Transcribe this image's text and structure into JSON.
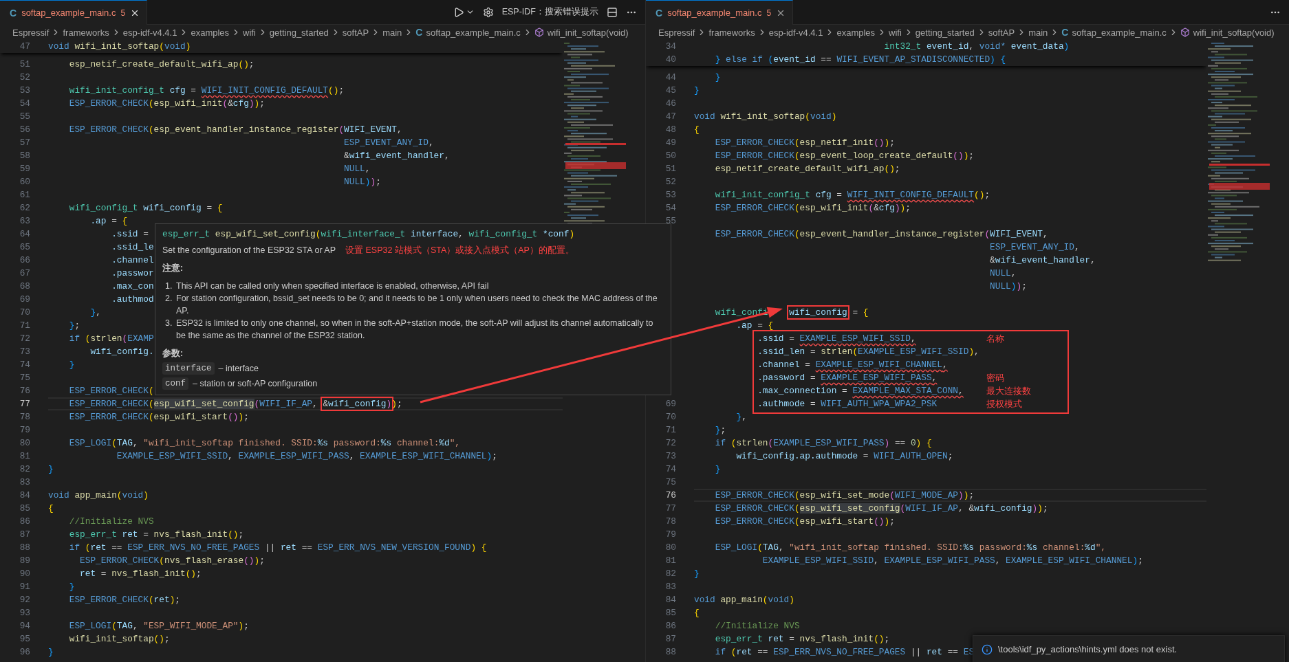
{
  "panes": [
    {
      "tab": {
        "icon": "C",
        "title": "softap_example_main.c",
        "problems": "5",
        "selected": true
      },
      "actions": [
        {
          "kind": "run"
        },
        {
          "kind": "settings"
        },
        {
          "kind": "text",
          "label": "ESP-IDF：搜索错误提示"
        },
        {
          "kind": "split"
        },
        {
          "kind": "more"
        }
      ],
      "breadcrumbs": [
        {
          "kind": "folder",
          "label": "Espressif"
        },
        {
          "kind": "folder",
          "label": "frameworks"
        },
        {
          "kind": "folder",
          "label": "esp-idf-v4.4.1"
        },
        {
          "kind": "folder",
          "label": "examples"
        },
        {
          "kind": "folder",
          "label": "wifi"
        },
        {
          "kind": "folder",
          "label": "getting_started"
        },
        {
          "kind": "folder",
          "label": "softAP"
        },
        {
          "kind": "folder",
          "label": "main"
        },
        {
          "kind": "file",
          "icon": "C",
          "label": "softap_example_main.c"
        },
        {
          "kind": "symbol",
          "label": "wifi_init_softap(void)"
        }
      ],
      "sticky": [
        {
          "n": "47",
          "current": false,
          "tokens": [
            {
              "kind": "keyword",
              "text": "void "
            },
            {
              "kind": "function",
              "text": "wifi_init_softap("
            },
            {
              "kind": "keyword",
              "text": "void)"
            }
          ]
        }
      ],
      "lines": [
        {
          "n": "51",
          "current": false,
          "framed": false,
          "tokens": [
            {
              "kind": "function",
              "text": "    esp_netif_create_default_wifi_ap();"
            }
          ]
        },
        {
          "n": "52",
          "current": false,
          "framed": false
        },
        {
          "n": "53",
          "current": false,
          "framed": false,
          "tokens": [
            {
              "kind": "type",
              "text": "    wifi_init_config_t "
            },
            {
              "kind": "variable",
              "text": "cfg = "
            },
            {
              "kind": "error",
              "text": "WIFI_INIT_CONFIG_DEFAULT"
            },
            {
              "kind": "plain",
              "text": "();"
            }
          ]
        },
        {
          "n": "54",
          "current": false,
          "framed": false,
          "tokens": [
            {
              "kind": "macro",
              "text": "    ESP_ERROR_CHECK("
            },
            {
              "kind": "function",
              "text": "esp_wifi_init("
            },
            {
              "kind": "variable",
              "text": "&cfg));"
            }
          ]
        },
        {
          "n": "55",
          "current": false,
          "framed": false
        },
        {
          "n": "56",
          "current": false,
          "framed": false,
          "tokens": [
            {
              "kind": "macro",
              "text": "    ESP_ERROR_CHECK("
            },
            {
              "kind": "function",
              "text": "esp_event_handler_instance_register("
            },
            {
              "kind": "variable",
              "text": "WIFI_EVENT,"
            }
          ]
        },
        {
          "n": "57",
          "current": false,
          "framed": false,
          "tokens": [
            {
              "kind": "macro",
              "text": "                                                        ESP_EVENT_ANY_ID,"
            }
          ]
        },
        {
          "n": "58",
          "current": false,
          "framed": false,
          "tokens": [
            {
              "kind": "variable",
              "text": "                                                        &wifi_event_handler,"
            }
          ]
        },
        {
          "n": "59",
          "current": false,
          "framed": false,
          "tokens": [
            {
              "kind": "macro",
              "text": "                                                        NULL,"
            }
          ]
        },
        {
          "n": "60",
          "current": false,
          "framed": false,
          "tokens": [
            {
              "kind": "macro",
              "text": "                                                        NULL));"
            }
          ]
        },
        {
          "n": "61",
          "current": false,
          "framed": false
        },
        {
          "n": "62",
          "current": false,
          "framed": false,
          "tokens": [
            {
              "kind": "type",
              "text": "    wifi_config_t "
            },
            {
              "kind": "variable",
              "text": "wifi_config = {"
            }
          ]
        },
        {
          "n": "63",
          "current": false,
          "framed": false,
          "tokens": [
            {
              "kind": "variable",
              "text": "        .ap = {"
            }
          ]
        },
        {
          "n": "64",
          "current": false,
          "framed": false,
          "tokens": [
            {
              "kind": "variable",
              "text": "            .ssid ="
            }
          ]
        },
        {
          "n": "65",
          "current": false,
          "framed": false,
          "tokens": [
            {
              "kind": "variable",
              "text": "            .ssid_le"
            }
          ]
        },
        {
          "n": "66",
          "current": false,
          "framed": false,
          "tokens": [
            {
              "kind": "variable",
              "text": "            .channel"
            }
          ]
        },
        {
          "n": "67",
          "current": false,
          "framed": false,
          "tokens": [
            {
              "kind": "variable",
              "text": "            .passwor"
            }
          ]
        },
        {
          "n": "68",
          "current": false,
          "framed": false,
          "tokens": [
            {
              "kind": "variable",
              "text": "            .max_con"
            }
          ]
        },
        {
          "n": "69",
          "current": false,
          "framed": false,
          "tokens": [
            {
              "kind": "variable",
              "text": "            .authmod"
            }
          ]
        },
        {
          "n": "70",
          "current": false,
          "framed": false,
          "tokens": [
            {
              "kind": "plain",
              "text": "        },"
            }
          ]
        },
        {
          "n": "71",
          "current": false,
          "framed": false,
          "tokens": [
            {
              "kind": "plain",
              "text": "    };"
            }
          ]
        },
        {
          "n": "72",
          "current": false,
          "framed": false,
          "tokens": [
            {
              "kind": "keyword",
              "text": "    if ("
            },
            {
              "kind": "function",
              "text": "strlen("
            },
            {
              "kind": "macro",
              "text": "EXAMP"
            }
          ]
        },
        {
          "n": "73",
          "current": false,
          "framed": false,
          "tokens": [
            {
              "kind": "variable",
              "text": "        wifi_config."
            }
          ]
        },
        {
          "n": "74",
          "current": false,
          "framed": false,
          "tokens": [
            {
              "kind": "plain",
              "text": "    }"
            }
          ]
        },
        {
          "n": "75",
          "current": false,
          "framed": false
        },
        {
          "n": "76",
          "current": false,
          "framed": false,
          "tokens": [
            {
              "kind": "macro",
              "text": "    ESP_ERROR_CHECK("
            }
          ]
        },
        {
          "n": "77",
          "current": true,
          "framed": false,
          "tokens": [
            {
              "kind": "macro",
              "text": "    ESP_ERROR_CHECK("
            },
            {
              "kind": "selected",
              "text": "esp_wifi_set_config"
            },
            {
              "kind": "macro",
              "text": "(WIFI_IF_AP, "
            },
            {
              "kind": "box",
              "tokens": [
                {
                  "kind": "variable",
                  "text": "&wifi_config)"
                }
              ]
            },
            {
              "kind": "plain",
              "text": ");"
            }
          ]
        },
        {
          "n": "78",
          "current": false,
          "framed": false,
          "tokens": [
            {
              "kind": "macro",
              "text": "    ESP_ERROR_CHECK("
            },
            {
              "kind": "function",
              "text": "esp_wifi_start());"
            }
          ]
        },
        {
          "n": "79",
          "current": false,
          "framed": false
        },
        {
          "n": "80",
          "current": false,
          "framed": false,
          "tokens": [
            {
              "kind": "macro",
              "text": "    ESP_LOGI("
            },
            {
              "kind": "variable",
              "text": "TAG, "
            },
            {
              "kind": "string",
              "text": "\"wifi_init_softap finished. SSID:"
            },
            {
              "kind": "escape",
              "text": "%s"
            },
            {
              "kind": "string",
              "text": " password:"
            },
            {
              "kind": "escape",
              "text": "%s"
            },
            {
              "kind": "string",
              "text": " channel:"
            },
            {
              "kind": "escape",
              "text": "%d"
            },
            {
              "kind": "string",
              "text": "\","
            }
          ]
        },
        {
          "n": "81",
          "current": false,
          "framed": false,
          "tokens": [
            {
              "kind": "macro",
              "text": "             EXAMPLE_ESP_WIFI_SSID, EXAMPLE_ESP_WIFI_PASS, EXAMPLE_ESP_WIFI_CHANNEL);"
            }
          ]
        },
        {
          "n": "82",
          "current": false,
          "framed": false,
          "tokens": [
            {
              "kind": "plain",
              "text": "}"
            }
          ]
        },
        {
          "n": "83",
          "current": false,
          "framed": false
        },
        {
          "n": "84",
          "current": false,
          "framed": false,
          "tokens": [
            {
              "kind": "keyword",
              "text": "void "
            },
            {
              "kind": "function",
              "text": "app_main("
            },
            {
              "kind": "keyword",
              "text": "void)"
            }
          ]
        },
        {
          "n": "85",
          "current": false,
          "framed": false,
          "tokens": [
            {
              "kind": "plain",
              "text": "{"
            }
          ]
        },
        {
          "n": "86",
          "current": false,
          "framed": false,
          "tokens": [
            {
              "kind": "comment",
              "text": "    //Initialize NVS"
            }
          ]
        },
        {
          "n": "87",
          "current": false,
          "framed": false,
          "tokens": [
            {
              "kind": "type",
              "text": "    esp_err_t "
            },
            {
              "kind": "variable",
              "text": "ret = "
            },
            {
              "kind": "function",
              "text": "nvs_flash_init();"
            }
          ]
        },
        {
          "n": "88",
          "current": false,
          "framed": false,
          "tokens": [
            {
              "kind": "keyword",
              "text": "    if ("
            },
            {
              "kind": "variable",
              "text": "ret == "
            },
            {
              "kind": "macro",
              "text": "ESP_ERR_NVS_NO_FREE_PAGES || "
            },
            {
              "kind": "variable",
              "text": "ret == "
            },
            {
              "kind": "macro",
              "text": "ESP_ERR_NVS_NEW_VERSION_FOUND) {"
            }
          ]
        },
        {
          "n": "89",
          "current": false,
          "framed": false,
          "tokens": [
            {
              "kind": "macro",
              "text": "      ESP_ERROR_CHECK("
            },
            {
              "kind": "function",
              "text": "nvs_flash_erase());"
            }
          ]
        },
        {
          "n": "90",
          "current": false,
          "framed": false,
          "tokens": [
            {
              "kind": "variable",
              "text": "      ret = "
            },
            {
              "kind": "function",
              "text": "nvs_flash_init();"
            }
          ]
        },
        {
          "n": "91",
          "current": false,
          "framed": false,
          "tokens": [
            {
              "kind": "plain",
              "text": "    }"
            }
          ]
        },
        {
          "n": "92",
          "current": false,
          "framed": false,
          "tokens": [
            {
              "kind": "macro",
              "text": "    ESP_ERROR_CHECK("
            },
            {
              "kind": "variable",
              "text": "ret);"
            }
          ]
        },
        {
          "n": "93",
          "current": false,
          "framed": false
        },
        {
          "n": "94",
          "current": false,
          "framed": false,
          "tokens": [
            {
              "kind": "macro",
              "text": "    ESP_LOGI("
            },
            {
              "kind": "variable",
              "text": "TAG, "
            },
            {
              "kind": "string",
              "text": "\"ESP_WIFI_MODE_AP\""
            },
            {
              "kind": "plain",
              "text": ");"
            }
          ]
        },
        {
          "n": "95",
          "current": false,
          "framed": false,
          "tokens": [
            {
              "kind": "function",
              "text": "    wifi_init_softap();"
            }
          ]
        },
        {
          "n": "96",
          "current": false,
          "framed": false,
          "tokens": [
            {
              "kind": "plain",
              "text": "}"
            }
          ]
        }
      ]
    },
    {
      "tab": {
        "icon": "C",
        "title": "softap_example_main.c",
        "problems": "5",
        "selected": true
      },
      "actions": [
        {
          "kind": "more"
        }
      ],
      "breadcrumbs": [
        {
          "kind": "folder",
          "label": "Espressif"
        },
        {
          "kind": "folder",
          "label": "frameworks"
        },
        {
          "kind": "folder",
          "label": "esp-idf-v4.4.1"
        },
        {
          "kind": "folder",
          "label": "examples"
        },
        {
          "kind": "folder",
          "label": "wifi"
        },
        {
          "kind": "folder",
          "label": "getting_started"
        },
        {
          "kind": "folder",
          "label": "softAP"
        },
        {
          "kind": "folder",
          "label": "main"
        },
        {
          "kind": "file",
          "icon": "C",
          "label": "softap_example_main.c"
        },
        {
          "kind": "symbol",
          "label": "wifi_init_softap(void)"
        }
      ],
      "sticky": [
        {
          "n": "34",
          "current": false,
          "tokens": [
            {
              "kind": "type",
              "text": "                                    int32_t "
            },
            {
              "kind": "variable",
              "text": "event_id, "
            },
            {
              "kind": "keyword",
              "text": "void* "
            },
            {
              "kind": "variable",
              "text": "event_data)"
            }
          ]
        },
        {
          "n": "40",
          "current": false,
          "tokens": [
            {
              "kind": "plain",
              "text": "    } "
            },
            {
              "kind": "keyword",
              "text": "else if ("
            },
            {
              "kind": "variable",
              "text": "event_id == "
            },
            {
              "kind": "macro",
              "text": "WIFI_EVENT_AP_STADISCONNECTED) {"
            }
          ]
        }
      ],
      "lines": [
        {
          "n": "44",
          "current": false,
          "framed": false,
          "tokens": [
            {
              "kind": "plain",
              "text": "    }"
            }
          ]
        },
        {
          "n": "45",
          "current": false,
          "framed": false,
          "tokens": [
            {
              "kind": "plain",
              "text": "}"
            }
          ]
        },
        {
          "n": "46",
          "current": false,
          "framed": false
        },
        {
          "n": "47",
          "current": false,
          "framed": false,
          "tokens": [
            {
              "kind": "keyword",
              "text": "void "
            },
            {
              "kind": "function",
              "text": "wifi_init_softap("
            },
            {
              "kind": "keyword",
              "text": "void)"
            }
          ]
        },
        {
          "n": "48",
          "current": false,
          "framed": false,
          "tokens": [
            {
              "kind": "plain",
              "text": "{"
            }
          ]
        },
        {
          "n": "49",
          "current": false,
          "framed": false,
          "tokens": [
            {
              "kind": "macro",
              "text": "    ESP_ERROR_CHECK("
            },
            {
              "kind": "function",
              "text": "esp_netif_init());"
            }
          ]
        },
        {
          "n": "50",
          "current": false,
          "framed": false,
          "tokens": [
            {
              "kind": "macro",
              "text": "    ESP_ERROR_CHECK("
            },
            {
              "kind": "function",
              "text": "esp_event_loop_create_default());"
            }
          ]
        },
        {
          "n": "51",
          "current": false,
          "framed": false,
          "tokens": [
            {
              "kind": "function",
              "text": "    esp_netif_create_default_wifi_ap();"
            }
          ]
        },
        {
          "n": "52",
          "current": false,
          "framed": false
        },
        {
          "n": "53",
          "current": false,
          "framed": false,
          "tokens": [
            {
              "kind": "type",
              "text": "    wifi_init_config_t "
            },
            {
              "kind": "variable",
              "text": "cfg = "
            },
            {
              "kind": "error",
              "text": "WIFI_INIT_CONFIG_DEFAULT"
            },
            {
              "kind": "plain",
              "text": "();"
            }
          ]
        },
        {
          "n": "54",
          "current": false,
          "framed": false,
          "tokens": [
            {
              "kind": "macro",
              "text": "    ESP_ERROR_CHECK("
            },
            {
              "kind": "function",
              "text": "esp_wifi_init("
            },
            {
              "kind": "variable",
              "text": "&cfg));"
            }
          ]
        },
        {
          "n": "55",
          "current": false,
          "framed": false
        },
        {
          "framed": false,
          "tokens": [
            {
              "kind": "macro",
              "text": "    ESP_ERROR_CHECK("
            },
            {
              "kind": "function",
              "text": "esp_event_handler_instance_register("
            },
            {
              "kind": "variable",
              "text": "WIFI_EVENT,"
            }
          ]
        },
        {
          "framed": false,
          "tokens": [
            {
              "kind": "macro",
              "text": "                                                        ESP_EVENT_ANY_ID,"
            }
          ]
        },
        {
          "framed": false,
          "tokens": [
            {
              "kind": "variable",
              "text": "                                                        &wifi_event_handler,"
            }
          ]
        },
        {
          "framed": false,
          "tokens": [
            {
              "kind": "macro",
              "text": "                                                        NULL,"
            }
          ]
        },
        {
          "framed": false,
          "tokens": [
            {
              "kind": "macro",
              "text": "                                                        NULL));"
            }
          ]
        },
        {
          "framed": false
        },
        {
          "framed": false,
          "tokens": [
            {
              "kind": "type",
              "text": "    wifi_confi"
            },
            {
              "kind": "covered"
            },
            {
              "kind": "box",
              "tokens": [
                {
                  "kind": "variable",
                  "text": "wifi_config"
                }
              ]
            },
            {
              "kind": "plain",
              "text": " = {"
            }
          ]
        },
        {
          "framed": false,
          "tokens": [
            {
              "kind": "variable",
              "text": "        .ap = {"
            }
          ]
        },
        {
          "framed": true,
          "note": "名称",
          "tokens": [
            {
              "kind": "variable",
              "text": "            .ssid = "
            },
            {
              "kind": "error",
              "text": "EXAMPLE_ESP_WIFI_SSID,"
            }
          ]
        },
        {
          "framed": true,
          "tokens": [
            {
              "kind": "variable",
              "text": "            .ssid_len = "
            },
            {
              "kind": "function",
              "text": "strlen("
            },
            {
              "kind": "macro",
              "text": "EXAMPLE_ESP_WIFI_SSID),"
            }
          ]
        },
        {
          "framed": true,
          "tokens": [
            {
              "kind": "variable",
              "text": "            .channel = "
            },
            {
              "kind": "error",
              "text": "EXAMPLE_ESP_WIFI_CHANNEL,"
            }
          ]
        },
        {
          "framed": true,
          "note": "密码",
          "tokens": [
            {
              "kind": "variable",
              "text": "            .password = "
            },
            {
              "kind": "error",
              "text": "EXAMPLE_ESP_WIFI_PASS,"
            }
          ]
        },
        {
          "framed": true,
          "note": "最大连接数",
          "tokens": [
            {
              "kind": "variable",
              "text": "            .max_connection = "
            },
            {
              "kind": "error",
              "text": "EXAMPLE_MAX_STA_CONN,"
            }
          ]
        },
        {
          "n": "69",
          "current": false,
          "framed": true,
          "note": "授权模式",
          "tokens": [
            {
              "kind": "variable",
              "text": "            .authmode = "
            },
            {
              "kind": "macro",
              "text": "WIFI_AUTH_WPA_WPA2_PSK"
            }
          ]
        },
        {
          "n": "70",
          "current": false,
          "framed": false,
          "tokens": [
            {
              "kind": "plain",
              "text": "        },"
            }
          ]
        },
        {
          "n": "71",
          "current": false,
          "framed": false,
          "tokens": [
            {
              "kind": "plain",
              "text": "    };"
            }
          ]
        },
        {
          "n": "72",
          "current": false,
          "framed": false,
          "tokens": [
            {
              "kind": "keyword",
              "text": "    if ("
            },
            {
              "kind": "function",
              "text": "strlen("
            },
            {
              "kind": "macro",
              "text": "EXAMPLE_ESP_WIFI_PASS) == "
            },
            {
              "kind": "number",
              "text": "0"
            },
            {
              "kind": "plain",
              "text": ") {"
            }
          ]
        },
        {
          "n": "73",
          "current": false,
          "framed": false,
          "tokens": [
            {
              "kind": "variable",
              "text": "        wifi_config.ap.authmode = "
            },
            {
              "kind": "macro",
              "text": "WIFI_AUTH_OPEN;"
            }
          ]
        },
        {
          "n": "74",
          "current": false,
          "framed": false,
          "tokens": [
            {
              "kind": "plain",
              "text": "    }"
            }
          ]
        },
        {
          "n": "75",
          "current": false,
          "framed": false
        },
        {
          "n": "76",
          "current": true,
          "framed": false,
          "tokens": [
            {
              "kind": "macro",
              "text": "    ESP_ERROR_CHECK("
            },
            {
              "kind": "function",
              "text": "esp_wifi_set_mode("
            },
            {
              "kind": "macro",
              "text": "WIFI_MODE_AP));"
            }
          ]
        },
        {
          "n": "77",
          "current": false,
          "framed": false,
          "tokens": [
            {
              "kind": "macro",
              "text": "    ESP_ERROR_CHECK("
            },
            {
              "kind": "selected",
              "text": "esp_wifi_set_config"
            },
            {
              "kind": "macro",
              "text": "(WIFI_IF_AP, "
            },
            {
              "kind": "variable",
              "text": "&wifi_config));"
            }
          ]
        },
        {
          "n": "78",
          "current": false,
          "framed": false,
          "tokens": [
            {
              "kind": "macro",
              "text": "    ESP_ERROR_CHECK("
            },
            {
              "kind": "function",
              "text": "esp_wifi_start());"
            }
          ]
        },
        {
          "n": "79",
          "current": false,
          "framed": false
        },
        {
          "n": "80",
          "current": false,
          "framed": false,
          "tokens": [
            {
              "kind": "macro",
              "text": "    ESP_LOGI("
            },
            {
              "kind": "variable",
              "text": "TAG, "
            },
            {
              "kind": "string",
              "text": "\"wifi_init_softap finished. SSID:"
            },
            {
              "kind": "escape",
              "text": "%s"
            },
            {
              "kind": "string",
              "text": " password:"
            },
            {
              "kind": "escape",
              "text": "%s"
            },
            {
              "kind": "string",
              "text": " channel:"
            },
            {
              "kind": "escape",
              "text": "%d"
            },
            {
              "kind": "string",
              "text": "\","
            }
          ]
        },
        {
          "n": "81",
          "current": false,
          "framed": false,
          "tokens": [
            {
              "kind": "macro",
              "text": "             EXAMPLE_ESP_WIFI_SSID, EXAMPLE_ESP_WIFI_PASS, EXAMPLE_ESP_WIFI_CHANNEL);"
            }
          ]
        },
        {
          "n": "82",
          "current": false,
          "framed": false,
          "tokens": [
            {
              "kind": "plain",
              "text": "}"
            }
          ]
        },
        {
          "n": "83",
          "current": false,
          "framed": false
        },
        {
          "n": "84",
          "current": false,
          "framed": false,
          "tokens": [
            {
              "kind": "keyword",
              "text": "void "
            },
            {
              "kind": "function",
              "text": "app_main("
            },
            {
              "kind": "keyword",
              "text": "void)"
            }
          ]
        },
        {
          "n": "85",
          "current": false,
          "framed": false,
          "tokens": [
            {
              "kind": "plain",
              "text": "{"
            }
          ]
        },
        {
          "n": "86",
          "current": false,
          "framed": false,
          "tokens": [
            {
              "kind": "comment",
              "text": "    //Initialize NVS"
            }
          ]
        },
        {
          "n": "87",
          "current": false,
          "framed": false,
          "tokens": [
            {
              "kind": "type",
              "text": "    esp_err_t "
            },
            {
              "kind": "variable",
              "text": "ret = "
            },
            {
              "kind": "function",
              "text": "nvs_flash_init();"
            }
          ]
        },
        {
          "n": "88",
          "current": false,
          "framed": false,
          "tokens": [
            {
              "kind": "keyword",
              "text": "    if ("
            },
            {
              "kind": "variable",
              "text": "ret == "
            },
            {
              "kind": "macro",
              "text": "ESP_ERR_NVS_NO_FREE_PAGES || "
            },
            {
              "kind": "variable",
              "text": "ret == "
            },
            {
              "kind": "macro",
              "text": "ES"
            }
          ]
        }
      ]
    }
  ],
  "hover": {
    "signature": [
      {
        "kind": "type",
        "text": "esp_err_t "
      },
      {
        "kind": "function",
        "text": "esp_wifi_set_config("
      },
      {
        "kind": "type",
        "text": "wifi_interface_t "
      },
      {
        "kind": "variable",
        "text": "interface, "
      },
      {
        "kind": "type",
        "text": "wifi_config_t "
      },
      {
        "kind": "variable",
        "text": "*conf)"
      }
    ],
    "description": "Set the configuration of the ESP32 STA or AP",
    "translation": "设置 ESP32 站模式（STA）或接入点模式（AP）的配置。",
    "notes_heading": "注意:",
    "notes": [
      {
        "marker": "1.",
        "text": "This API can be called only when specified interface is enabled, otherwise, API fail"
      },
      {
        "marker": "2.",
        "text": "For station configuration, bssid_set needs to be 0; and it needs to be 1 only when users need to check the MAC address of the AP."
      },
      {
        "marker": "3.",
        "text": "ESP32 is limited to only one channel, so when in the soft-AP+station mode, the soft-AP will adjust its channel automatically to be the same as the channel of the ESP32 station."
      }
    ],
    "params_heading": "参数:",
    "params": [
      {
        "name": "interface",
        "description": "– interface"
      },
      {
        "name": "conf",
        "description": "– station or soft-AP configuration"
      }
    ]
  },
  "notification": {
    "kind": "info",
    "text": "\\tools\\idf_py_actions\\hints.yml does not exist."
  }
}
